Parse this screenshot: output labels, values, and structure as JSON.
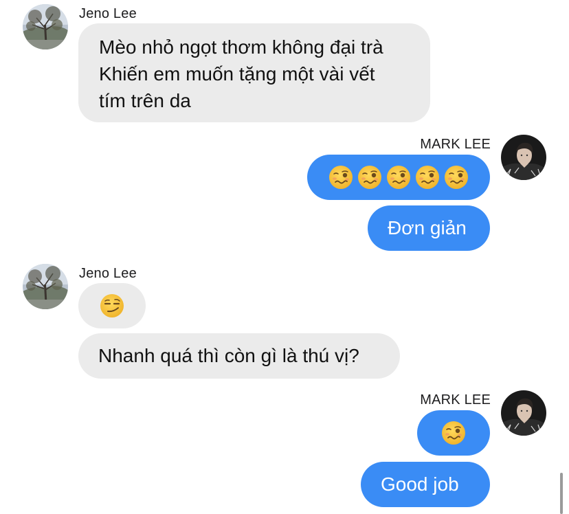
{
  "conversation": {
    "groups": [
      {
        "sender": "Jeno Lee",
        "side": "left",
        "avatar_icon": "tree-photo-avatar",
        "messages": [
          {
            "lines": [
              "Mèo nhỏ ngọt thơm không đại trà",
              "Khiến em muốn tặng một vài vết",
              "tím trên da"
            ]
          }
        ]
      },
      {
        "sender": "MARK LEE",
        "side": "right",
        "avatar_icon": "person-photo-avatar",
        "messages": [
          {
            "emoji": [
              "woozy-face",
              "woozy-face",
              "woozy-face",
              "woozy-face",
              "woozy-face"
            ]
          },
          {
            "text": "Đơn giản"
          }
        ]
      },
      {
        "sender": "Jeno Lee",
        "side": "left",
        "avatar_icon": "tree-photo-avatar",
        "messages": [
          {
            "emoji": [
              "smirking-face"
            ]
          },
          {
            "text": "Nhanh quá thì còn gì là thú vị?"
          }
        ]
      },
      {
        "sender": "MARK LEE",
        "side": "right",
        "avatar_icon": "person-photo-avatar",
        "messages": [
          {
            "emoji": [
              "woozy-face"
            ]
          },
          {
            "text": "Good job"
          }
        ]
      }
    ]
  },
  "colors": {
    "incoming_bubble": "#ebebeb",
    "outgoing_bubble": "#3a8cf5",
    "emoji_yellow": "#f7c840"
  }
}
